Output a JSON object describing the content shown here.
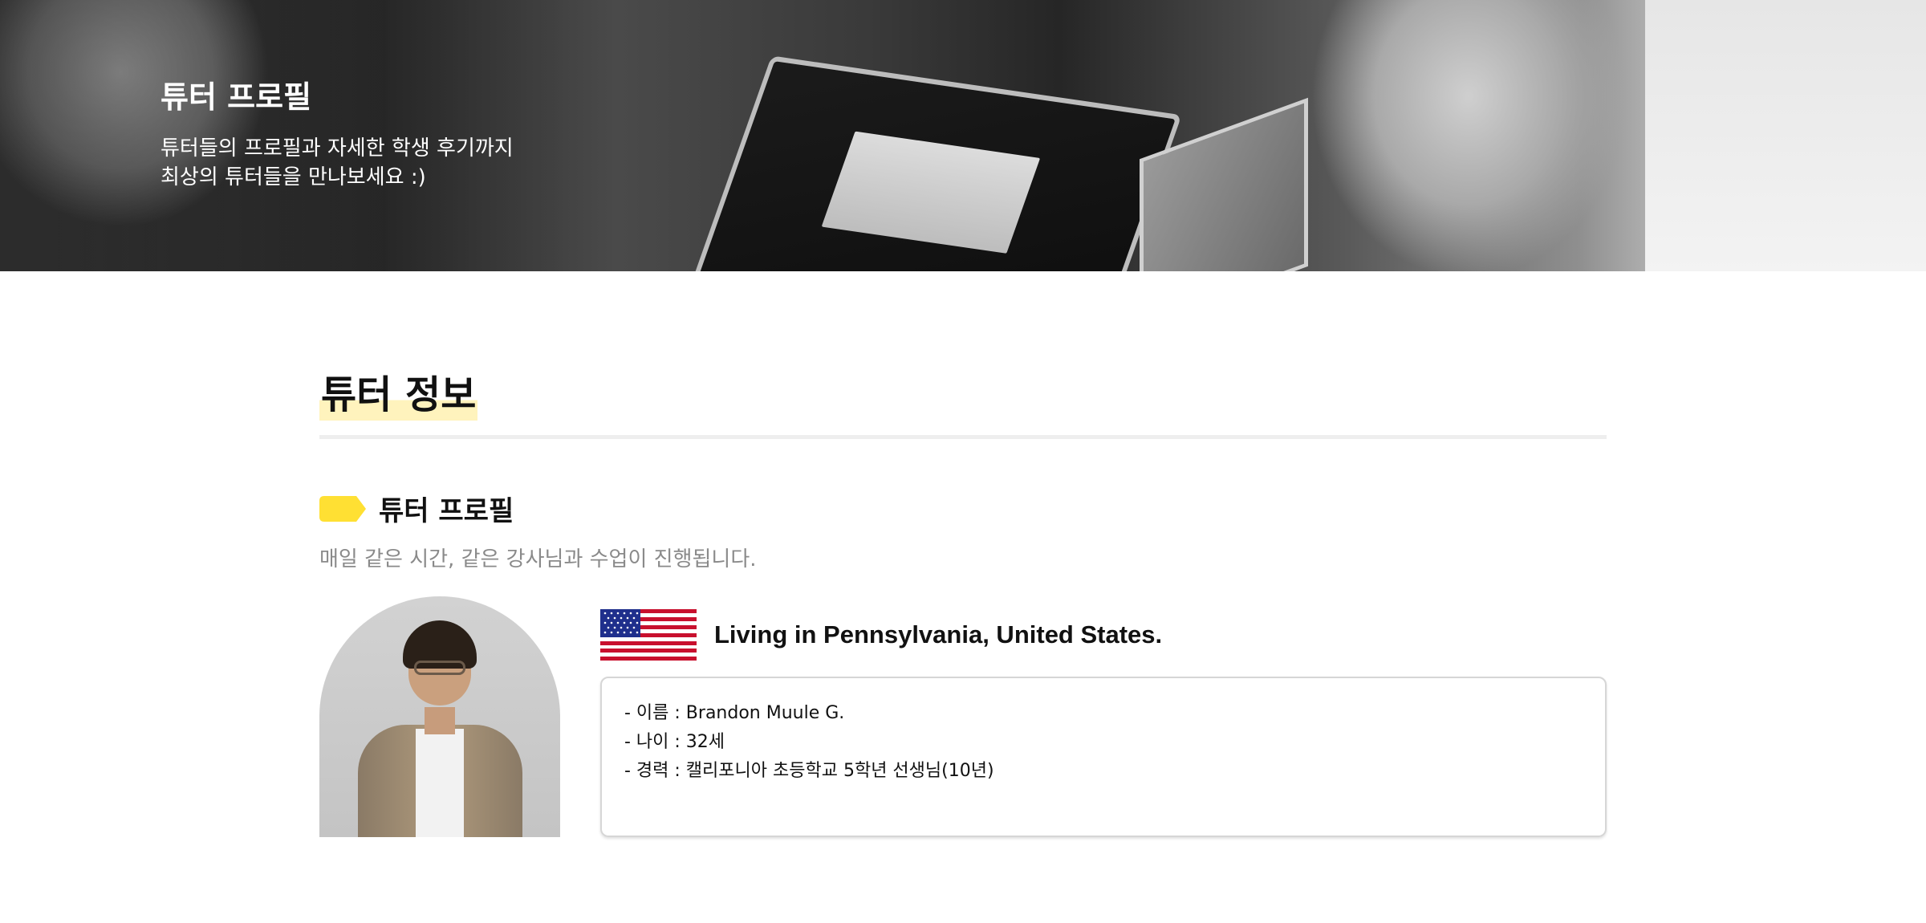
{
  "hero": {
    "title": "튜터 프로필",
    "subtitle_line1": "튜터들의 프로필과 자세한 학생 후기까지",
    "subtitle_line2": "최상의 튜터들을 만나보세요 :)"
  },
  "section": {
    "title": "튜터 정보"
  },
  "profile_block": {
    "title": "튜터 프로필",
    "description": "매일 같은 시간, 같은 강사님과 수업이 진행됩니다.",
    "tag_icon": "yellow-tag-icon",
    "tag_color": "#FFE033"
  },
  "tutor": {
    "flag": "us-flag-icon",
    "location": "Living in Pennsylvania, United States.",
    "info": [
      "- 이름 : Brandon Muule G.",
      "- 나이 : 32세",
      "- 경력 : 캘리포니아 초등학교 5학년 선생님(10년)"
    ]
  },
  "colors": {
    "accent_yellow": "#FFE033",
    "highlight": "#FFF3BD",
    "muted_text": "#8A8A8A"
  }
}
